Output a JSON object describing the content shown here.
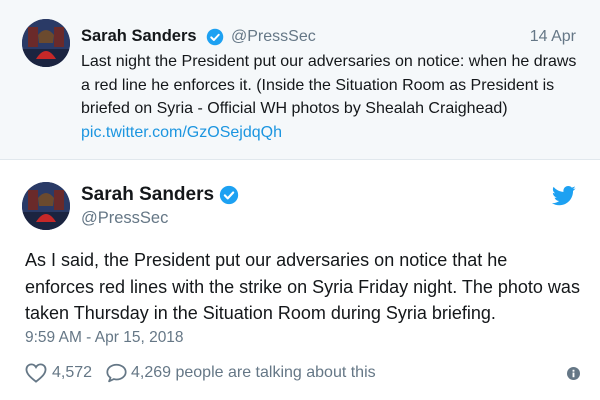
{
  "quoted_tweet": {
    "name": "Sarah Sanders",
    "handle": "@PressSec",
    "date": "14 Apr",
    "text": "Last night the President put our adversaries on notice: when he draws a red line he enforces it. (Inside the Situation Room as President is briefed on Syria - Official WH photos by Shealah Craighead)",
    "link": "pic.twitter.com/GzOSejdqQh"
  },
  "tweet": {
    "name": "Sarah Sanders",
    "handle": "@PressSec",
    "text": "As I said, the President put our adversaries on notice that he enforces red lines with the strike on Syria Friday night. The photo was taken Thursday in the Situation Room during Syria briefing.",
    "timestamp": "9:59 AM - Apr 15, 2018"
  },
  "actions": {
    "likes": "4,572",
    "talking": "4,269 people are talking about this"
  },
  "icons": {
    "verified": "verified-badge-icon",
    "twitter": "twitter-bird-icon",
    "like": "heart-icon",
    "reply": "reply-bubble-icon",
    "info": "info-icon"
  },
  "colors": {
    "twitter_blue": "#1da1f2",
    "link_blue": "#1b95e0",
    "secondary_text": "#657786",
    "quoted_background": "#f5f8fa"
  }
}
